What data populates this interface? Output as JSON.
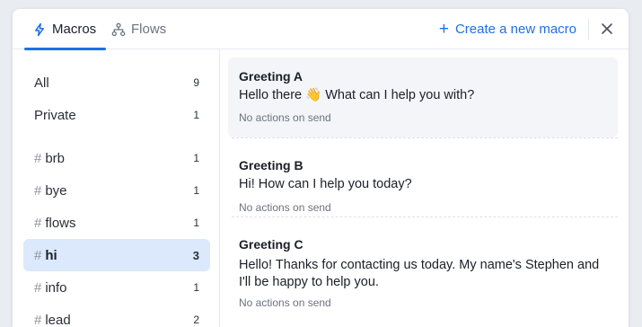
{
  "header": {
    "tabs": [
      {
        "label": "Macros",
        "icon": "lightning-icon",
        "active": true
      },
      {
        "label": "Flows",
        "icon": "flow-icon",
        "active": false
      }
    ],
    "create_label": "Create a new macro",
    "accent_color": "#1f6fe5"
  },
  "sidebar": {
    "items": [
      {
        "label": "All",
        "count": "9",
        "tag": false
      },
      {
        "label": "Private",
        "count": "1",
        "tag": false
      },
      {
        "label": "brb",
        "count": "1",
        "tag": true
      },
      {
        "label": "bye",
        "count": "1",
        "tag": true
      },
      {
        "label": "flows",
        "count": "1",
        "tag": true
      },
      {
        "label": "hi",
        "count": "3",
        "tag": true,
        "active": true
      },
      {
        "label": "info",
        "count": "1",
        "tag": true
      },
      {
        "label": "lead",
        "count": "2",
        "tag": true
      }
    ],
    "hash": "#"
  },
  "macros": [
    {
      "name": "Greeting A",
      "text": "Hello there 👋 What can I help you with?",
      "meta": "No actions on send"
    },
    {
      "name": "Greeting B",
      "text": "Hi! How can I help you today?",
      "meta": "No actions on send"
    },
    {
      "name": "Greeting C",
      "text": "Hello! Thanks for contacting us today. My name's Stephen and I'll be happy to help you.",
      "meta": "No actions on send"
    }
  ]
}
